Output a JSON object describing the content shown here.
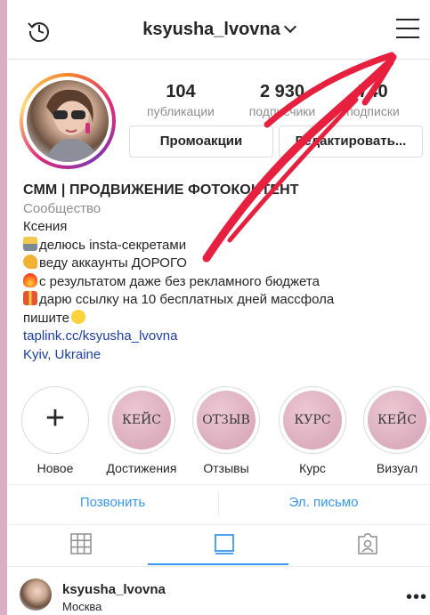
{
  "header": {
    "username": "ksyusha_lvovna"
  },
  "stats": [
    {
      "value": "104",
      "label": "публикации"
    },
    {
      "value": "2 930",
      "label": "подписчики"
    },
    {
      "value": "740",
      "label": "подписки"
    }
  ],
  "buttons": {
    "promo": "Промоакции",
    "edit": "Редактировать..."
  },
  "bio": {
    "title": "СММ | ПРОДВИЖЕНИЕ ФОТОКОНТЕНТ",
    "category": "Сообщество",
    "name": "Ксения",
    "lines": [
      "делюсь insta-секретами",
      "веду аккаунты ДОРОГО",
      "с результатом даже без рекламного бюджета",
      "дарю ссылку на 10 бесплатных дней массфола",
      "пишите"
    ],
    "link": "taplink.cc/ksyusha_lvovna",
    "location": "Kyiv, Ukraine"
  },
  "highlights": [
    {
      "cover": "",
      "label": "Новое"
    },
    {
      "cover": "КЕЙС",
      "label": "Достижения"
    },
    {
      "cover": "ОТЗЫВ",
      "label": "Отзывы"
    },
    {
      "cover": "КУРС",
      "label": "Курс"
    },
    {
      "cover": "КЕЙС",
      "label": "Визуал"
    }
  ],
  "actions": {
    "call": "Позвонить",
    "email": "Эл. письмо"
  },
  "post": {
    "username": "ksyusha_lvovna",
    "location": "Москва"
  },
  "colors": {
    "link_blue": "#3897f0",
    "arrow_red": "#e8203f",
    "frame_pink": "#dcaec3"
  },
  "icons": [
    "history-icon",
    "chevron-down-icon",
    "menu-icon",
    "grid-icon",
    "feed-icon",
    "tagged-icon",
    "more-icon"
  ]
}
